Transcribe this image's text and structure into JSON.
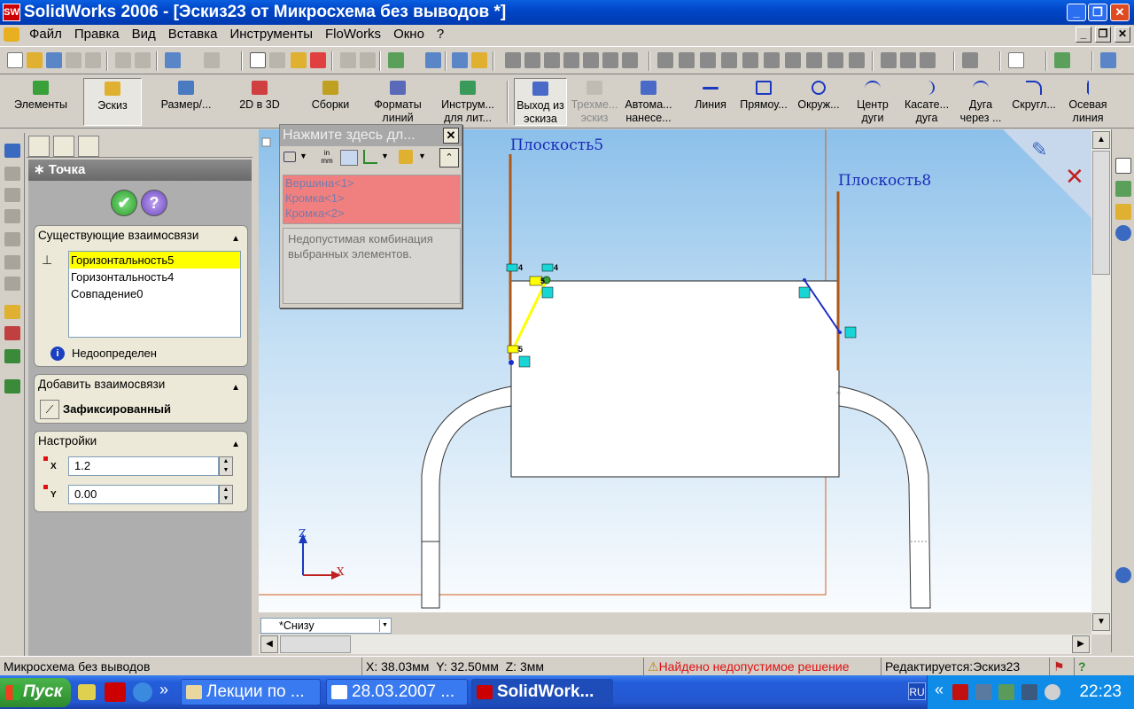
{
  "window": {
    "title": "SolidWorks 2006 - [Эскиз23 от Микросхема без выводов *]",
    "app_icon_label": "SW"
  },
  "menu": [
    "Файл",
    "Правка",
    "Вид",
    "Вставка",
    "Инструменты",
    "FloWorks",
    "Окно",
    "?"
  ],
  "command_manager": {
    "left": [
      {
        "label": "Элементы",
        "icon": "features-icon"
      },
      {
        "label": "Эскиз",
        "icon": "sketch-icon"
      },
      {
        "label": "Размер/...",
        "icon": "dimension-icon"
      },
      {
        "label": "2D в 3D",
        "icon": "2d-to-3d-icon"
      },
      {
        "label": "Сборки",
        "icon": "assembly-icon"
      },
      {
        "label": "Форматы\nлиний",
        "icon": "line-format-icon"
      },
      {
        "label": "Инструм...\nдля лит...",
        "icon": "mold-tools-icon"
      }
    ],
    "right": [
      {
        "label": "Выход из\nэскиза",
        "icon": "exit-sketch-icon"
      },
      {
        "label": "Трехме...\nэскиз",
        "icon": "3d-sketch-icon"
      },
      {
        "label": "Автома...\nнанесе...",
        "icon": "auto-dimension-icon"
      },
      {
        "label": "Линия",
        "icon": "line-icon"
      },
      {
        "label": "Прямоу...",
        "icon": "rectangle-icon"
      },
      {
        "label": "Окруж...",
        "icon": "circle-icon"
      },
      {
        "label": "Центр\nдуги",
        "icon": "center-arc-icon"
      },
      {
        "label": "Касате...\nдуга",
        "icon": "tangent-arc-icon"
      },
      {
        "label": "Дуга\nчерез ...",
        "icon": "three-point-arc-icon"
      },
      {
        "label": "Скругл...",
        "icon": "fillet-icon"
      },
      {
        "label": "Осевая\nлиния",
        "icon": "centerline-icon"
      }
    ]
  },
  "property_manager": {
    "title": "Точка",
    "ok_symbol": "✔",
    "help_symbol": "?",
    "existing_relations": {
      "header": "Существующие взаимосвязи",
      "items": [
        "Горизонтальность5",
        "Горизонтальность4",
        "Совпадение0"
      ],
      "selected_index": 0,
      "status": "Недоопределен"
    },
    "add_relations": {
      "header": "Добавить взаимосвязи",
      "fixed_label": "Зафиксированный"
    },
    "settings": {
      "header": "Настройки",
      "x_label": "X",
      "x_value": "1.2",
      "y_label": "Y",
      "y_value": "0.00"
    }
  },
  "selection_dialog": {
    "title": "Нажмите здесь дл...",
    "close_symbol": "✕",
    "entities": [
      "Вершина<1>",
      "Кромка<1>",
      "Кромка<2>"
    ],
    "message": "Недопустимая комбинация выбранных элементов."
  },
  "viewport": {
    "plane_labels": [
      "Плоскость5",
      "Плоскость8"
    ],
    "axis_z": "Z",
    "axis_x": "X",
    "relation_tags": [
      "4",
      "4",
      "5",
      "5"
    ],
    "view_name": "*Снизу",
    "colors": {
      "plane_label": "#1a2ab8",
      "plane_line": "#b05818",
      "sketch_line": "#1b2dc8",
      "highlight": "#ffff00"
    }
  },
  "status": {
    "doc": "Микросхема без выводов",
    "x": "X: 38.03мм",
    "y": "Y: 32.50мм",
    "z": "Z: 3мм",
    "warning": "Найдено недопустимое решение",
    "editing": "Редактируется:Эскиз23",
    "help": "?"
  },
  "taskbar": {
    "start": "Пуск",
    "tasks": [
      "Лекции по ...",
      "28.03.2007 ...",
      "SolidWork..."
    ],
    "lang": "RU",
    "clock": "22:23",
    "chevron": "«"
  }
}
